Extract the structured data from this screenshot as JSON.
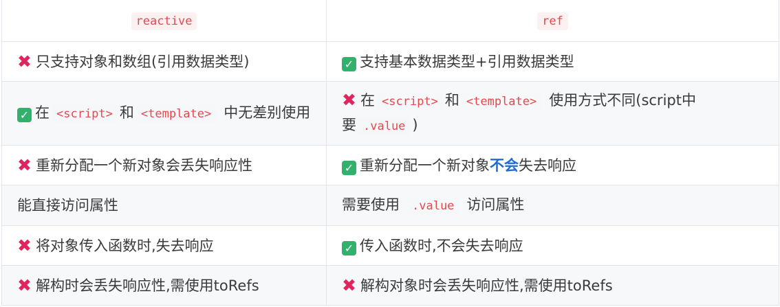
{
  "header": {
    "left": "reactive",
    "right": "ref"
  },
  "rows": [
    {
      "left": {
        "mark": "cross",
        "text": "只支持对象和数组(引用数据类型)"
      },
      "right": {
        "mark": "check",
        "text": "支持基本数据类型+引用数据类型"
      }
    },
    {
      "left": {
        "mark": "check",
        "pre": "在",
        "code1": "<script>",
        "mid": "和",
        "code2": "<template>",
        "post": "中无差别使用"
      },
      "right": {
        "mark": "cross",
        "pre": "在",
        "code1": "<script>",
        "mid": "和",
        "code2": "<template>",
        "post1": "使用方式不同(script中",
        "post2": "要",
        "code3": ".value",
        "post3": ")"
      }
    },
    {
      "left": {
        "mark": "cross",
        "text": "重新分配一个新对象会丢失响应性"
      },
      "right": {
        "mark": "check",
        "pre": "重新分配一个新对象",
        "bold": "不会",
        "post": "失去响应"
      }
    },
    {
      "left": {
        "text": "能直接访问属性"
      },
      "right": {
        "pre": "需要使用",
        "code": ".value",
        "post": "访问属性"
      }
    },
    {
      "left": {
        "mark": "cross",
        "text": "将对象传入函数时,失去响应"
      },
      "right": {
        "mark": "check",
        "text": "传入函数时,不会失去响应"
      }
    },
    {
      "left": {
        "mark": "cross",
        "text": "解构时会丢失响应性,需使用toRefs"
      },
      "right": {
        "mark": "cross",
        "text": "解构对象时会丢失响应性,需使用toRefs"
      }
    }
  ],
  "icons": {
    "cross": "cross-mark-icon",
    "check": "check-mark-icon"
  },
  "colors": {
    "cross": "#e0245e",
    "check": "#32b16c",
    "code": "#e5484d",
    "highlight": "#1e6bd6",
    "stripe": "#f6f8fa"
  }
}
